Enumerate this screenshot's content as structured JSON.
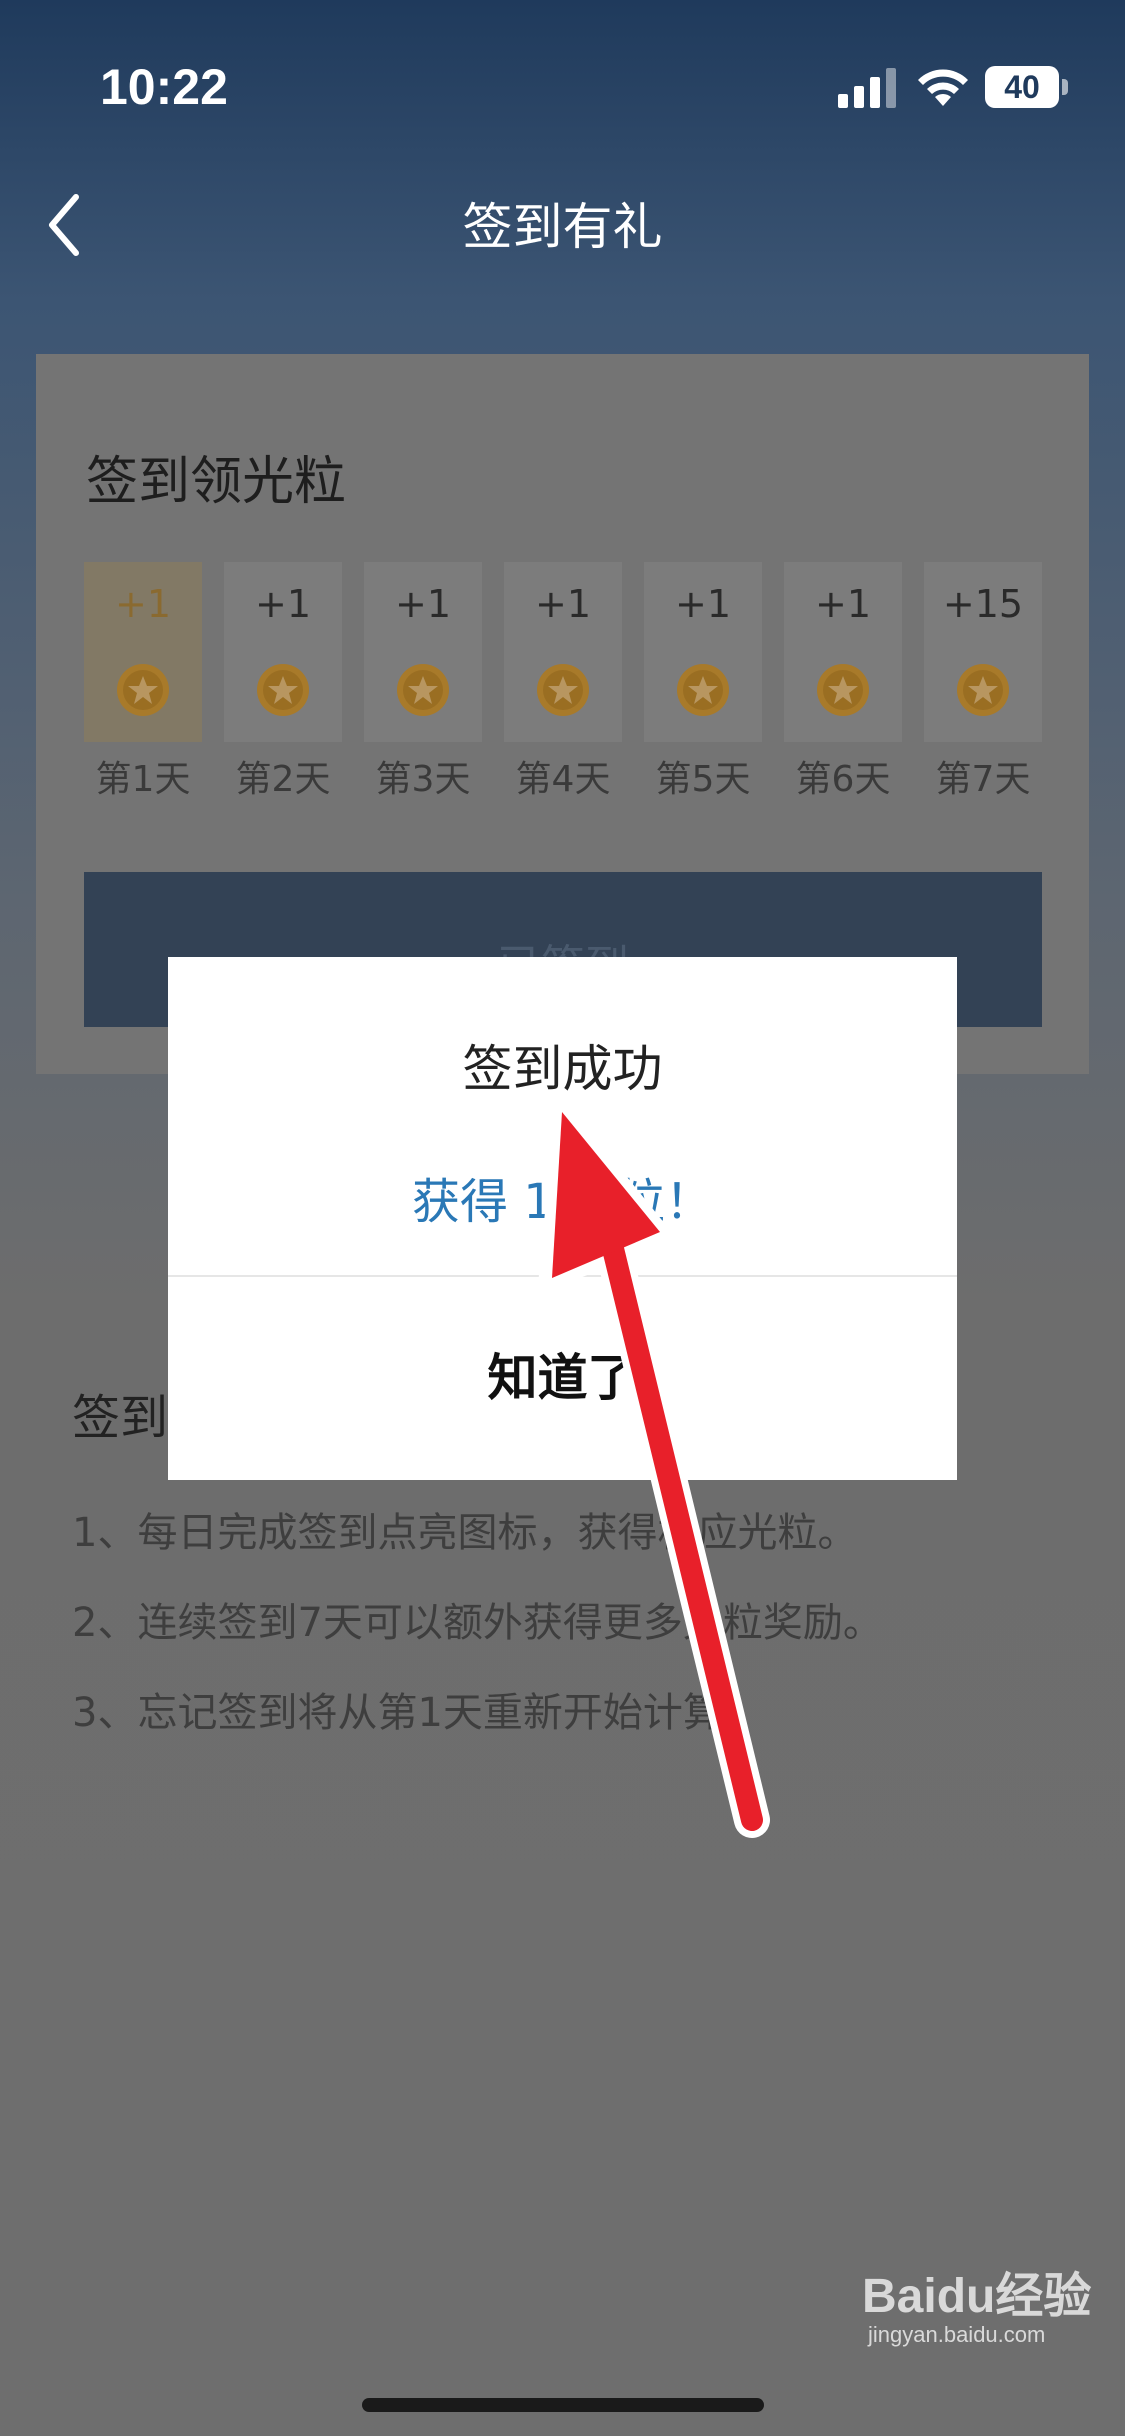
{
  "status_bar": {
    "time": "10:22",
    "battery": "40"
  },
  "nav": {
    "title": "签到有礼"
  },
  "checkin": {
    "title": "签到领光粒",
    "days": [
      {
        "points": "+1",
        "label": "第1天",
        "active": true
      },
      {
        "points": "+1",
        "label": "第2天",
        "active": false
      },
      {
        "points": "+1",
        "label": "第3天",
        "active": false
      },
      {
        "points": "+1",
        "label": "第4天",
        "active": false
      },
      {
        "points": "+1",
        "label": "第5天",
        "active": false
      },
      {
        "points": "+1",
        "label": "第6天",
        "active": false
      },
      {
        "points": "+15",
        "label": "第7天",
        "active": false
      }
    ],
    "button_label": "已签到"
  },
  "rules": {
    "title": "签到",
    "items": [
      "1、每日完成签到点亮图标，获得相应光粒。",
      "2、连续签到7天可以额外获得更多光粒奖励。",
      "3、忘记签到将从第1天重新开始计算。"
    ]
  },
  "dialog": {
    "title": "签到成功",
    "message": "获得 1 光粒！",
    "ok_label": "知道了"
  },
  "watermark": {
    "logo": "Baidu经验",
    "url": "jingyan.baidu.com"
  },
  "colors": {
    "accent_blue": "#2a78b6",
    "annotation_red": "#e8202a",
    "coin_gold": "#e0a030"
  }
}
